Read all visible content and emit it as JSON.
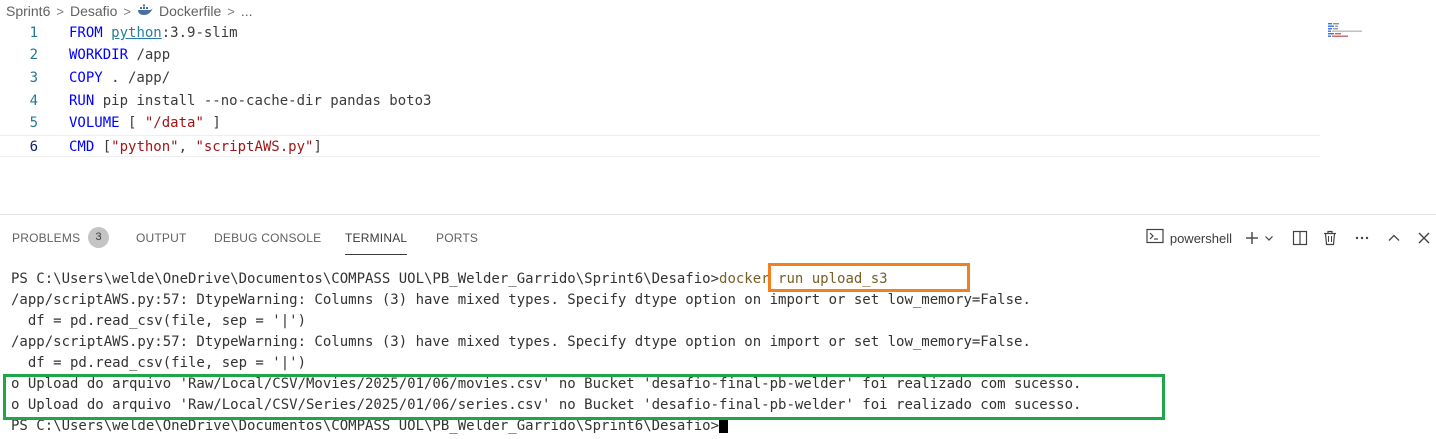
{
  "breadcrumb": {
    "items": [
      "Sprint6",
      "Desafio",
      "Dockerfile",
      "..."
    ],
    "separator": ">"
  },
  "editor": {
    "lines": [
      {
        "number": "1",
        "keyword": "FROM",
        "image": "python",
        "rest": ":3.9-slim"
      },
      {
        "number": "2",
        "keyword": "WORKDIR",
        "rest": " /app"
      },
      {
        "number": "3",
        "keyword": "COPY",
        "rest": " . /app/"
      },
      {
        "number": "4",
        "keyword": "RUN",
        "rest": " pip install --no-cache-dir pandas boto3"
      },
      {
        "number": "5",
        "keyword": "VOLUME",
        "rest_a": " [ ",
        "string": "\"/data\"",
        "rest_b": " ]"
      },
      {
        "number": "6",
        "keyword": "CMD",
        "rest_a": " [",
        "string1": "\"python\"",
        "rest_b": ", ",
        "string2": "\"scriptAWS.py\"",
        "rest_c": "]"
      }
    ]
  },
  "panel": {
    "tabs": [
      {
        "label": "PROBLEMS",
        "badge": "3"
      },
      {
        "label": "OUTPUT"
      },
      {
        "label": "DEBUG CONSOLE"
      },
      {
        "label": "TERMINAL",
        "active": true
      },
      {
        "label": "PORTS"
      }
    ],
    "shell": "powershell",
    "icons": [
      "terminal-icon",
      "plus-icon",
      "chevron-down-icon",
      "split-icon",
      "trash-icon",
      "more-icon",
      "chevron-up-icon",
      "close-icon"
    ]
  },
  "terminal": {
    "prompt1": "PS C:\\Users\\welde\\OneDrive\\Documentos\\COMPASS UOL\\PB_Welder_Garrido\\Sprint6\\Desafio>",
    "command": "docker run upload_s3",
    "warning1": "/app/scriptAWS.py:57: DtypeWarning: Columns (3) have mixed types. Specify dtype option on import or set low_memory=False.",
    "code1": "  df = pd.read_csv(file, sep = '|')",
    "warning2": "/app/scriptAWS.py:57: DtypeWarning: Columns (3) have mixed types. Specify dtype option on import or set low_memory=False.",
    "code2": "  df = pd.read_csv(file, sep = '|')",
    "upload1": "o Upload do arquivo 'Raw/Local/CSV/Movies/2025/01/06/movies.csv' no Bucket 'desafio-final-pb-welder' foi realizado com sucesso.",
    "upload2": "o Upload do arquivo 'Raw/Local/CSV/Series/2025/01/06/series.csv' no Bucket 'desafio-final-pb-welder' foi realizado com sucesso.",
    "prompt2": "PS C:\\Users\\welde\\OneDrive\\Documentos\\COMPASS UOL\\PB_Welder_Garrido\\Sprint6\\Desafio>"
  },
  "colors": {
    "highlight_command": "#f47f1f",
    "highlight_success": "#1fa64a",
    "keyword": "#0000ff",
    "string": "#a31515"
  }
}
